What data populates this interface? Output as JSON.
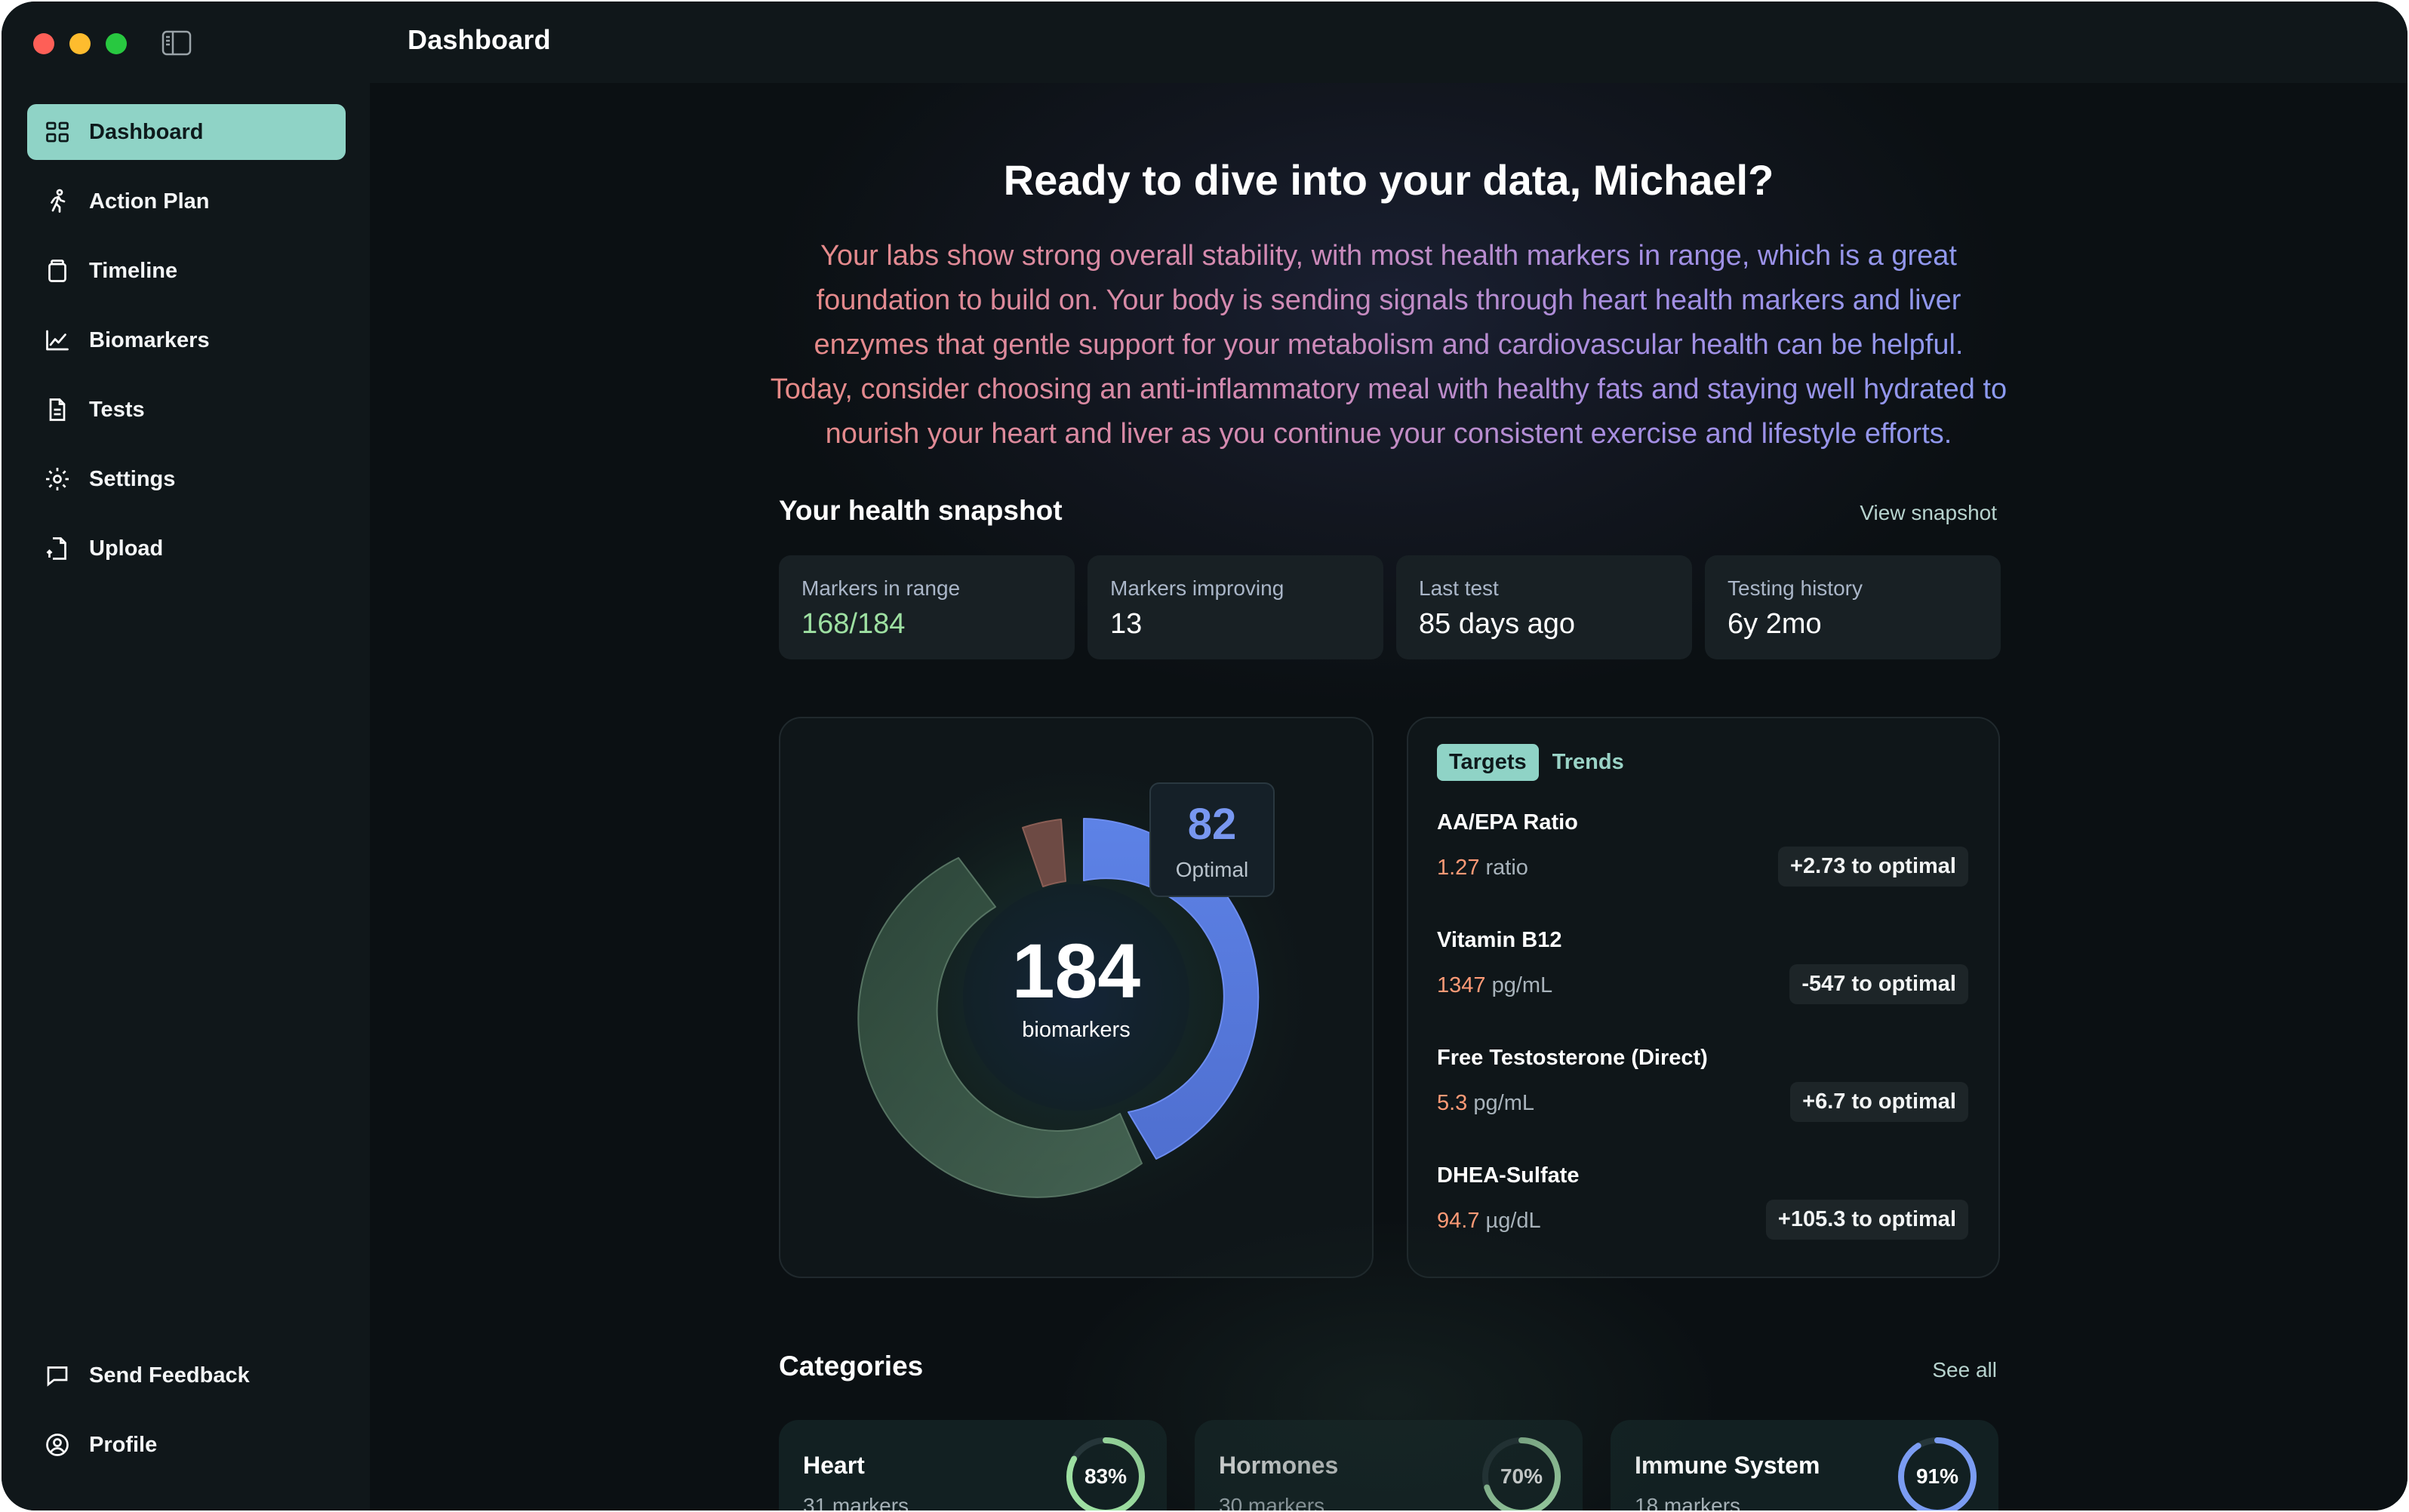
{
  "window": {
    "title": "Dashboard"
  },
  "sidebar": {
    "items": [
      {
        "label": "Dashboard",
        "icon": "grid-icon",
        "active": true
      },
      {
        "label": "Action Plan",
        "icon": "runner-icon"
      },
      {
        "label": "Timeline",
        "icon": "jar-icon"
      },
      {
        "label": "Biomarkers",
        "icon": "line-chart-icon"
      },
      {
        "label": "Tests",
        "icon": "document-icon"
      },
      {
        "label": "Settings",
        "icon": "gear-icon"
      },
      {
        "label": "Upload",
        "icon": "upload-document-icon"
      }
    ],
    "footer": [
      {
        "label": "Send Feedback",
        "icon": "chat-bubble-icon"
      },
      {
        "label": "Profile",
        "icon": "user-circle-icon"
      }
    ]
  },
  "hero": {
    "title": "Ready to dive into your data, Michael?",
    "text": "Your labs show strong overall stability, with most health markers in range, which is a great foundation to build on. Your body is sending signals through heart health markers and liver enzymes that gentle support for your metabolism and cardiovascular health can be helpful. Today, consider choosing an anti-inflammatory meal with healthy fats and staying well hydrated to nourish your heart and liver as you continue your consistent exercise and lifestyle efforts."
  },
  "snapshot": {
    "title": "Your health snapshot",
    "link": "View snapshot",
    "cards": [
      {
        "label": "Markers in range",
        "value": "168/184"
      },
      {
        "label": "Markers improving",
        "value": "13"
      },
      {
        "label": "Last test",
        "value": "85 days ago"
      },
      {
        "label": "Testing history",
        "value": "6y 2mo"
      }
    ]
  },
  "donut": {
    "total": "184",
    "total_label": "biomarkers",
    "callout_value": "82",
    "callout_label": "Optimal",
    "colors": {
      "optimal": "#5b7fe0",
      "in_range": "#3c5a48",
      "out_of_range": "#7a4a42"
    }
  },
  "targets": {
    "tabs": [
      "Targets",
      "Trends"
    ],
    "active_tab": "Targets",
    "items": [
      {
        "name": "AA/EPA Ratio",
        "value": "1.27",
        "unit": "ratio",
        "delta": "+2.73 to optimal"
      },
      {
        "name": "Vitamin B12",
        "value": "1347",
        "unit": "pg/mL",
        "delta": "-547 to optimal"
      },
      {
        "name": "Free Testosterone (Direct)",
        "value": "5.3",
        "unit": "pg/mL",
        "delta": "+6.7 to optimal"
      },
      {
        "name": "DHEA-Sulfate",
        "value": "94.7",
        "unit": "µg/dL",
        "delta": "+105.3 to optimal"
      }
    ]
  },
  "categories": {
    "title": "Categories",
    "link": "See all",
    "items": [
      {
        "name": "Heart",
        "sub": "31 markers",
        "percent": "83%",
        "progress": 0.83,
        "color": "#9ee0a2"
      },
      {
        "name": "Hormones",
        "sub": "30 markers",
        "percent": "70%",
        "progress": 0.7,
        "color": "#a9e2b0"
      },
      {
        "name": "Immune System",
        "sub": "18 markers",
        "percent": "91%",
        "progress": 0.91,
        "color": "#7b9cf2"
      }
    ]
  }
}
